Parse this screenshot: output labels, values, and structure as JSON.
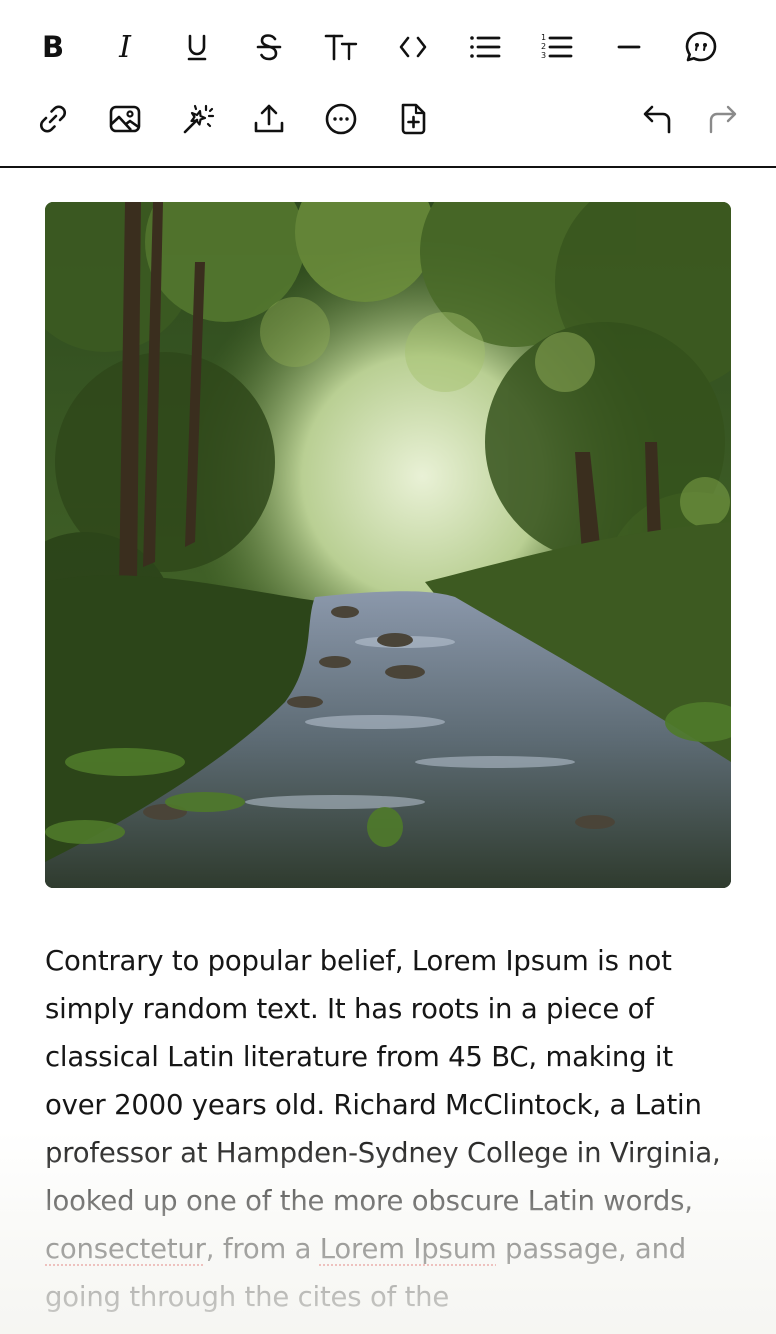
{
  "toolbar": {
    "row1": [
      {
        "name": "bold",
        "label": "B"
      },
      {
        "name": "italic",
        "label": "I"
      },
      {
        "name": "underline",
        "label": "U"
      },
      {
        "name": "strikethrough",
        "label": "S"
      },
      {
        "name": "text-size",
        "label": "TT"
      },
      {
        "name": "code",
        "label": "<>"
      },
      {
        "name": "bulleted-list",
        "label": ""
      },
      {
        "name": "numbered-list",
        "label": ""
      },
      {
        "name": "horizontal-rule",
        "label": ""
      },
      {
        "name": "quote",
        "label": ""
      }
    ],
    "row2": [
      {
        "name": "link",
        "label": ""
      },
      {
        "name": "image",
        "label": ""
      },
      {
        "name": "magic",
        "label": ""
      },
      {
        "name": "upload",
        "label": ""
      },
      {
        "name": "more",
        "label": ""
      },
      {
        "name": "add-document",
        "label": ""
      },
      {
        "name": "undo",
        "label": "",
        "enabled": true
      },
      {
        "name": "redo",
        "label": "",
        "enabled": false
      }
    ]
  },
  "editor": {
    "image_alt": "Forest stream",
    "paragraph": {
      "part1": "Contrary to popular belief, Lorem Ipsum is not simply random text. It has roots in a piece of classical Latin literature from 45 BC, making it over 2000 years old. Richard McClintock, a Latin professor at Hampden-Sydney College in Virginia, looked up one of the more obscure Latin words, ",
      "misspelled1": "consectetur",
      "part2": ", from a ",
      "misspelled2": "Lorem Ipsum",
      "part3": " passage, and going through the cites of the"
    }
  },
  "colors": {
    "text": "#161616",
    "disabled_icon": "#8a8a8a",
    "spellcheck": "#e05a5a"
  }
}
